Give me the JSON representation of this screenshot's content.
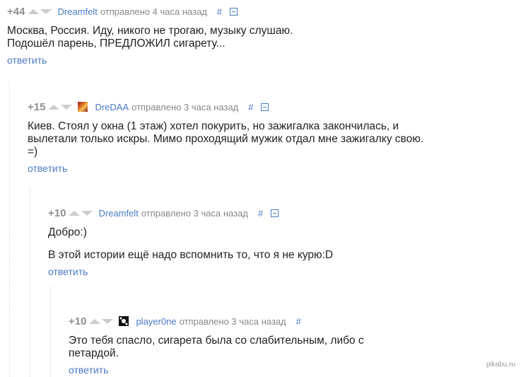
{
  "comments": [
    {
      "rating": "+44",
      "author": "Dreamfelt",
      "time": "отправлено 4 часа назад",
      "hash": "#",
      "lines": [
        "Москва, Россия. Иду, никого не трогаю, музыку слушаю.",
        "Подошёл парень, ПРЕДЛОЖИЛ сигарету..."
      ],
      "reply": "ответить"
    },
    {
      "rating": "+15",
      "author": "DreDAA",
      "time": "отправлено 3 часа назад",
      "hash": "#",
      "lines": [
        "Киев. Стоял у окна (1 этаж) хотел покурить, но зажигалка закончилась, и",
        "вылетали только искры. Мимо проходящий мужик отдал мне зажигалку свою.",
        "=)"
      ],
      "reply": "ответить"
    },
    {
      "rating": "+10",
      "author": "Dreamfelt",
      "time": "отправлено 3 часа назад",
      "hash": "#",
      "para1": "Добро:)",
      "para2": "В этой истории ещё надо вспомнить то, что я не курю:D",
      "reply": "ответить"
    },
    {
      "rating": "+10",
      "author": "player0ne",
      "time": "отправлено 3 часа назад",
      "hash": "#",
      "lines": [
        "Это тебя спасло, сигарета была со слабительным, либо с",
        "петардой."
      ],
      "reply": "ответить"
    }
  ],
  "watermark": "pikabu.ru",
  "colors": {
    "link": "#4a7bc4",
    "rating": "#8f8f8f",
    "meta": "#888888",
    "text": "#222222"
  }
}
